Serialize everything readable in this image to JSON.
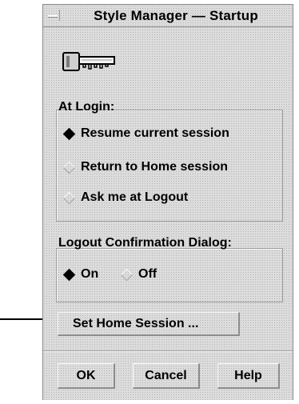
{
  "window": {
    "title": "Style Manager — Startup",
    "icons": {
      "menu": "window-menu-icon",
      "key": "key-icon"
    }
  },
  "at_login": {
    "title": "At Login:",
    "options": [
      {
        "label": "Resume current session",
        "selected": true
      },
      {
        "label": "Return to Home session",
        "selected": false
      },
      {
        "label": "Ask me at Logout",
        "selected": false
      }
    ]
  },
  "logout_confirmation": {
    "title": "Logout Confirmation Dialog:",
    "options": [
      {
        "label": "On",
        "selected": true
      },
      {
        "label": "Off",
        "selected": false
      }
    ]
  },
  "buttons": {
    "set_home": "Set Home Session ...",
    "ok": "OK",
    "cancel": "Cancel",
    "help": "Help"
  },
  "annotation": {
    "icon": "arrow-right-icon"
  },
  "colors": {
    "background": "#dcdcdc",
    "stipple": "#b4b4b4",
    "border": "#8c8c8c"
  }
}
